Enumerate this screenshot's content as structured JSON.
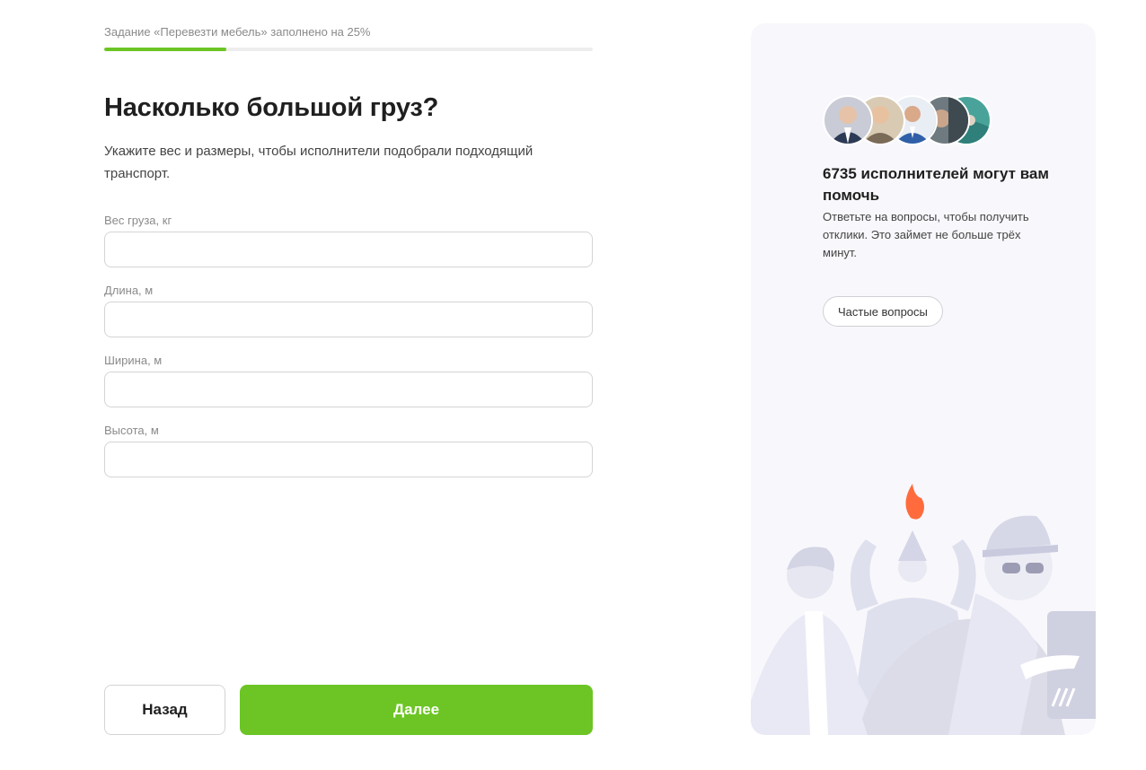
{
  "progress": {
    "label": "Задание «Перевезти мебель» заполнено на 25%",
    "percent": 25,
    "color": "#6cc524"
  },
  "form": {
    "title": "Насколько большой груз?",
    "subtitle": "Укажите вес и размеры, чтобы исполнители подобрали подходящий транспорт.",
    "fields": [
      {
        "label": "Вес груза, кг",
        "value": "",
        "placeholder": ""
      },
      {
        "label": "Длина, м",
        "value": "",
        "placeholder": ""
      },
      {
        "label": "Ширина, м",
        "value": "",
        "placeholder": ""
      },
      {
        "label": "Высота, м",
        "value": "",
        "placeholder": ""
      }
    ]
  },
  "actions": {
    "back_label": "Назад",
    "next_label": "Далее"
  },
  "side": {
    "count_title": "6735 исполнителей могут вам помочь",
    "count_text": "Ответьте на вопросы, чтобы получить отклики. Это займет не больше трёх минут.",
    "faq_label": "Частые вопросы",
    "avatars": [
      "avatar-photo",
      "avatar-photo",
      "avatar-photo",
      "avatar-photo",
      "avatar-photo"
    ],
    "accent_color": "#ff6b3d"
  }
}
